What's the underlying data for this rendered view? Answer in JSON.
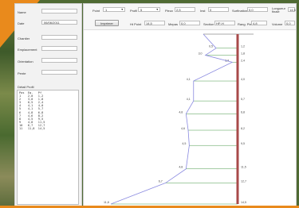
{
  "left_panel": {
    "fields": [
      {
        "label": "Name",
        "value": ""
      },
      {
        "label": "Date",
        "value": "06/06/2011"
      },
      {
        "label": "Chantier",
        "value": ""
      },
      {
        "label": "Emplacement",
        "value": ""
      },
      {
        "label": "Orientation",
        "value": ""
      },
      {
        "label": "Pente",
        "value": ""
      }
    ],
    "detail_label": "Détail Profil",
    "detail_header": "Pas  Eq.   Pf",
    "detail_rows": [
      "1    2,0   1,2",
      "2    3,0   1,8",
      "3    0,5   2,4",
      "4    4,1   4,0",
      "5    4,1   5,7",
      "6    4,8   6,8",
      "7    4,6   8,2",
      "8    4,5   9,5",
      "9    4,8   11,5",
      "10   6,7   12,7",
      "11   11,8  14,5"
    ]
  },
  "toolbar": {
    "point_label": "Point",
    "point_value": "1",
    "profil_label": "Profil",
    "profil_value": "5",
    "pieux_label": "Pieux",
    "pieux_value": "2,5",
    "inst_label": "Inst",
    "inst_value": "0",
    "surf_label": "Surfination",
    "surf_value": "0,0",
    "longueur_label": "Longueur finale",
    "longueur_value": "14,5",
    "imprimer_label": "Imprimer",
    "ht_label": "Ht Point",
    "ht_value": "14,5",
    "mepas_label": "Mepas",
    "mepas_value": "0,0",
    "section_label": "Section",
    "section_value": "HP-H",
    "rang_label": "Rang. Pieu",
    "rang_value": "4,8",
    "volume_label": "Volume",
    "volume_value": "0,0"
  },
  "chart_data": {
    "type": "line",
    "title": "",
    "xlabel": "",
    "ylabel": "",
    "depth": [
      0,
      1.2,
      1.8,
      2.4,
      4.0,
      5.7,
      6.8,
      8.2,
      9.5,
      11.5,
      12.7,
      14.5
    ],
    "equivalent": [
      0,
      2.0,
      3.0,
      0.5,
      4.1,
      4.1,
      4.8,
      4.6,
      4.5,
      4.8,
      6.7,
      11.8
    ],
    "equivalent_labels": [
      "",
      "0,5",
      "3,0",
      "3,8",
      "4,1",
      "4,1",
      "4,8",
      "4,6",
      "4,5",
      "4,8",
      "6,7",
      "11,8"
    ],
    "depth_labels": [
      "",
      "1,2",
      "1,8",
      "2,4",
      "4,0",
      "5,7",
      "6,8",
      "8,2",
      "9,5",
      "11,5",
      "12,7",
      "14,5"
    ],
    "series_color": "#8a8ae0",
    "grid_color": "#4a9a4a",
    "pile_color": "#a84a4a"
  }
}
